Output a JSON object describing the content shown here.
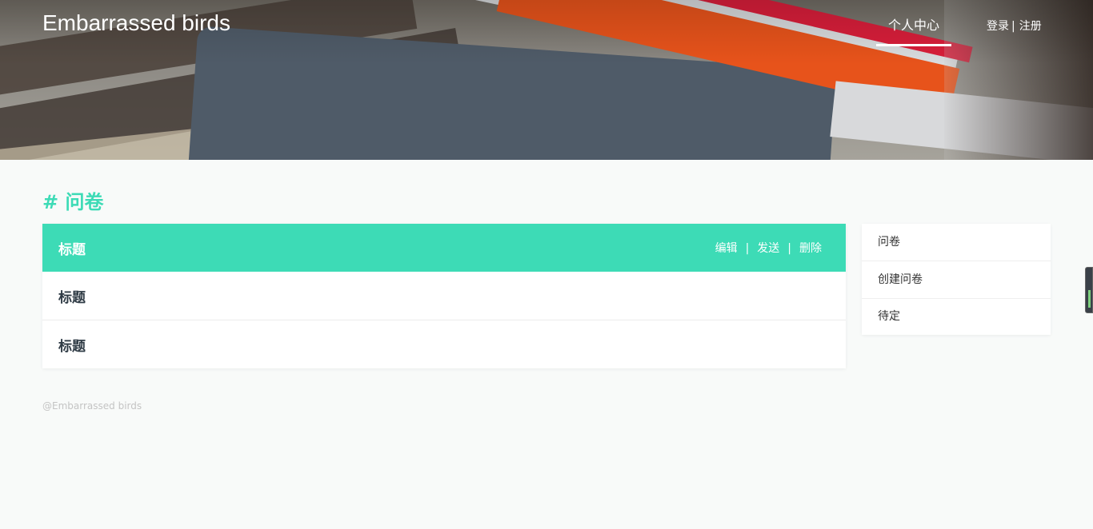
{
  "header": {
    "brand": "Embarrassed birds",
    "nav_center": "个人中心",
    "login": "登录",
    "separator": "|",
    "register": "注册"
  },
  "section": {
    "title": "# 问卷"
  },
  "list": {
    "rows": [
      {
        "title": "标题",
        "active": true
      },
      {
        "title": "标题",
        "active": false
      },
      {
        "title": "标题",
        "active": false
      }
    ],
    "actions": {
      "edit": "编辑",
      "send": "发送",
      "delete": "删除",
      "separator": "|"
    }
  },
  "side_menu": {
    "items": [
      "问卷",
      "创建问卷",
      "待定"
    ]
  },
  "footer": {
    "text": "@Embarrassed birds"
  },
  "colors": {
    "accent": "#3ddbb6",
    "background": "#f8faf9",
    "footer_text": "#c4c4c4"
  }
}
